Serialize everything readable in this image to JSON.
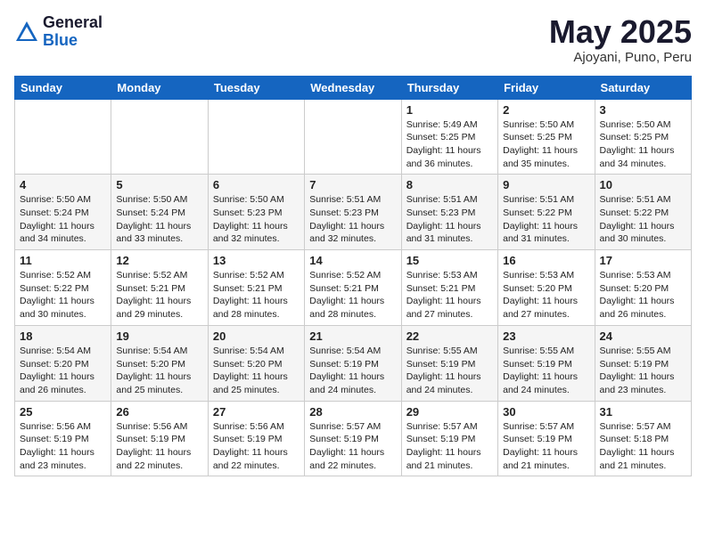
{
  "header": {
    "logo_general": "General",
    "logo_blue": "Blue",
    "month_title": "May 2025",
    "location": "Ajoyani, Puno, Peru"
  },
  "days_of_week": [
    "Sunday",
    "Monday",
    "Tuesday",
    "Wednesday",
    "Thursday",
    "Friday",
    "Saturday"
  ],
  "weeks": [
    [
      {
        "day": "",
        "info": ""
      },
      {
        "day": "",
        "info": ""
      },
      {
        "day": "",
        "info": ""
      },
      {
        "day": "",
        "info": ""
      },
      {
        "day": "1",
        "info": "Sunrise: 5:49 AM\nSunset: 5:25 PM\nDaylight: 11 hours\nand 36 minutes."
      },
      {
        "day": "2",
        "info": "Sunrise: 5:50 AM\nSunset: 5:25 PM\nDaylight: 11 hours\nand 35 minutes."
      },
      {
        "day": "3",
        "info": "Sunrise: 5:50 AM\nSunset: 5:25 PM\nDaylight: 11 hours\nand 34 minutes."
      }
    ],
    [
      {
        "day": "4",
        "info": "Sunrise: 5:50 AM\nSunset: 5:24 PM\nDaylight: 11 hours\nand 34 minutes."
      },
      {
        "day": "5",
        "info": "Sunrise: 5:50 AM\nSunset: 5:24 PM\nDaylight: 11 hours\nand 33 minutes."
      },
      {
        "day": "6",
        "info": "Sunrise: 5:50 AM\nSunset: 5:23 PM\nDaylight: 11 hours\nand 32 minutes."
      },
      {
        "day": "7",
        "info": "Sunrise: 5:51 AM\nSunset: 5:23 PM\nDaylight: 11 hours\nand 32 minutes."
      },
      {
        "day": "8",
        "info": "Sunrise: 5:51 AM\nSunset: 5:23 PM\nDaylight: 11 hours\nand 31 minutes."
      },
      {
        "day": "9",
        "info": "Sunrise: 5:51 AM\nSunset: 5:22 PM\nDaylight: 11 hours\nand 31 minutes."
      },
      {
        "day": "10",
        "info": "Sunrise: 5:51 AM\nSunset: 5:22 PM\nDaylight: 11 hours\nand 30 minutes."
      }
    ],
    [
      {
        "day": "11",
        "info": "Sunrise: 5:52 AM\nSunset: 5:22 PM\nDaylight: 11 hours\nand 30 minutes."
      },
      {
        "day": "12",
        "info": "Sunrise: 5:52 AM\nSunset: 5:21 PM\nDaylight: 11 hours\nand 29 minutes."
      },
      {
        "day": "13",
        "info": "Sunrise: 5:52 AM\nSunset: 5:21 PM\nDaylight: 11 hours\nand 28 minutes."
      },
      {
        "day": "14",
        "info": "Sunrise: 5:52 AM\nSunset: 5:21 PM\nDaylight: 11 hours\nand 28 minutes."
      },
      {
        "day": "15",
        "info": "Sunrise: 5:53 AM\nSunset: 5:21 PM\nDaylight: 11 hours\nand 27 minutes."
      },
      {
        "day": "16",
        "info": "Sunrise: 5:53 AM\nSunset: 5:20 PM\nDaylight: 11 hours\nand 27 minutes."
      },
      {
        "day": "17",
        "info": "Sunrise: 5:53 AM\nSunset: 5:20 PM\nDaylight: 11 hours\nand 26 minutes."
      }
    ],
    [
      {
        "day": "18",
        "info": "Sunrise: 5:54 AM\nSunset: 5:20 PM\nDaylight: 11 hours\nand 26 minutes."
      },
      {
        "day": "19",
        "info": "Sunrise: 5:54 AM\nSunset: 5:20 PM\nDaylight: 11 hours\nand 25 minutes."
      },
      {
        "day": "20",
        "info": "Sunrise: 5:54 AM\nSunset: 5:20 PM\nDaylight: 11 hours\nand 25 minutes."
      },
      {
        "day": "21",
        "info": "Sunrise: 5:54 AM\nSunset: 5:19 PM\nDaylight: 11 hours\nand 24 minutes."
      },
      {
        "day": "22",
        "info": "Sunrise: 5:55 AM\nSunset: 5:19 PM\nDaylight: 11 hours\nand 24 minutes."
      },
      {
        "day": "23",
        "info": "Sunrise: 5:55 AM\nSunset: 5:19 PM\nDaylight: 11 hours\nand 24 minutes."
      },
      {
        "day": "24",
        "info": "Sunrise: 5:55 AM\nSunset: 5:19 PM\nDaylight: 11 hours\nand 23 minutes."
      }
    ],
    [
      {
        "day": "25",
        "info": "Sunrise: 5:56 AM\nSunset: 5:19 PM\nDaylight: 11 hours\nand 23 minutes."
      },
      {
        "day": "26",
        "info": "Sunrise: 5:56 AM\nSunset: 5:19 PM\nDaylight: 11 hours\nand 22 minutes."
      },
      {
        "day": "27",
        "info": "Sunrise: 5:56 AM\nSunset: 5:19 PM\nDaylight: 11 hours\nand 22 minutes."
      },
      {
        "day": "28",
        "info": "Sunrise: 5:57 AM\nSunset: 5:19 PM\nDaylight: 11 hours\nand 22 minutes."
      },
      {
        "day": "29",
        "info": "Sunrise: 5:57 AM\nSunset: 5:19 PM\nDaylight: 11 hours\nand 21 minutes."
      },
      {
        "day": "30",
        "info": "Sunrise: 5:57 AM\nSunset: 5:19 PM\nDaylight: 11 hours\nand 21 minutes."
      },
      {
        "day": "31",
        "info": "Sunrise: 5:57 AM\nSunset: 5:18 PM\nDaylight: 11 hours\nand 21 minutes."
      }
    ]
  ]
}
